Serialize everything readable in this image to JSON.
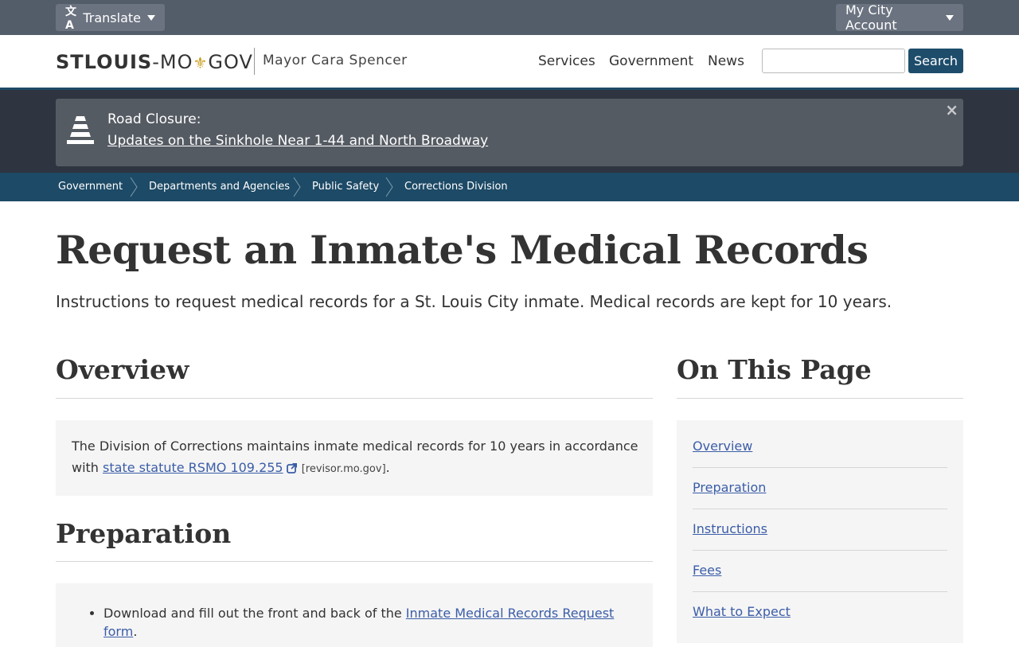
{
  "utility": {
    "translate_label": "Translate",
    "account_label": "My City Account"
  },
  "header": {
    "logo_bold": "STLOUIS",
    "logo_rest": "-MO",
    "logo_fleur": "⚜",
    "logo_gov": "GOV",
    "mayor": "Mayor Cara Spencer",
    "nav": [
      "Services",
      "Government",
      "News"
    ],
    "search_value": "",
    "search_button": "Search"
  },
  "alert": {
    "title": "Road Closure:",
    "link": "Updates on the Sinkhole Near 1-44 and North Broadway",
    "close": "×"
  },
  "breadcrumb": [
    "Government",
    "Departments and Agencies",
    "Public Safety",
    "Corrections Division"
  ],
  "page": {
    "title": "Request an Inmate's Medical Records",
    "lead": "Instructions to request medical records for a St. Louis City inmate. Medical records are kept for 10 years."
  },
  "overview": {
    "heading": "Overview",
    "text_1": "The Division of Corrections maintains inmate medical records for 10 years in accordance",
    "text_2": "with ",
    "link": "state statute RSMO 109.255",
    "domain": "[revisor.mo.gov]",
    "period": "."
  },
  "preparation": {
    "heading": "Preparation",
    "item_text": "Download and fill out the front and back of the ",
    "item_link_1": "Inmate Medical Records Request",
    "item_link_2": "form",
    "item_end": "."
  },
  "toc": {
    "heading": "On This Page",
    "items": [
      "Overview",
      "Preparation",
      "Instructions",
      "Fees",
      "What to Expect"
    ]
  },
  "colors": {
    "utility_bar": "#535c69",
    "breadcrumb_bar": "#1d4a66",
    "search_button": "#1e4d6b",
    "link": "#3b5da8"
  }
}
